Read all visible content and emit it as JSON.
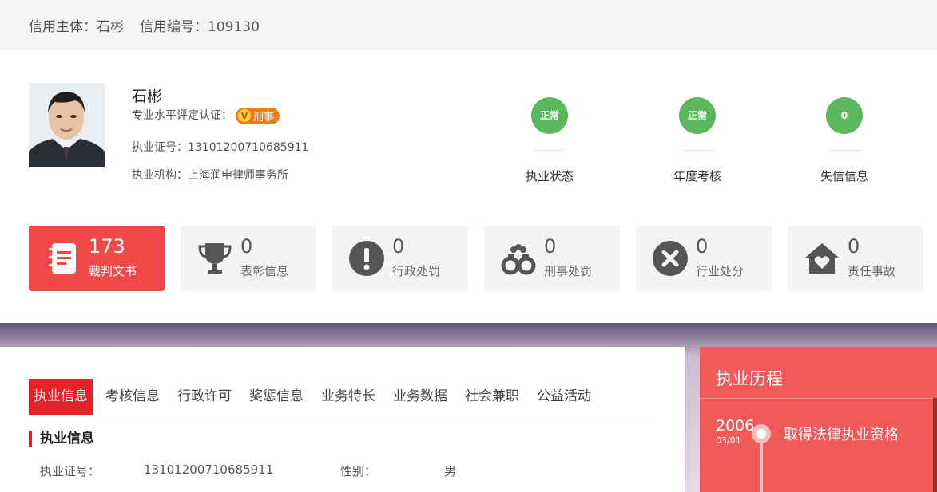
{
  "header": {
    "subject_label": "信用主体：",
    "subject_value": "石彬",
    "code_label": "信用编号：",
    "code_value": "109130"
  },
  "profile": {
    "name": "石彬",
    "cert_label": "专业水平评定认证：",
    "cert_badge": "刑事",
    "license_label": "执业证号：",
    "license_value": "13101200710685911",
    "org_label": "执业机构：",
    "org_value": "上海润申律师事务所"
  },
  "statuses": [
    {
      "value": "正常",
      "label": "执业状态"
    },
    {
      "value": "正常",
      "label": "年度考核"
    },
    {
      "value": "0",
      "label": "失信信息"
    }
  ],
  "stats": [
    {
      "icon": "document-icon",
      "value": "173",
      "label": "裁判文书",
      "active": true
    },
    {
      "icon": "trophy-icon",
      "value": "0",
      "label": "表彰信息"
    },
    {
      "icon": "exclamation-icon",
      "value": "0",
      "label": "行政处罚"
    },
    {
      "icon": "handcuffs-icon",
      "value": "0",
      "label": "刑事处罚"
    },
    {
      "icon": "x-circle-icon",
      "value": "0",
      "label": "行业处分"
    },
    {
      "icon": "house-heart-icon",
      "value": "0",
      "label": "责任事故"
    }
  ],
  "tabs": [
    "执业信息",
    "考核信息",
    "行政许可",
    "奖惩信息",
    "业务特长",
    "业务数据",
    "社会兼职",
    "公益活动"
  ],
  "section": {
    "title": "执业信息",
    "license_label": "执业证号：",
    "license_value": "13101200710685911",
    "gender_label": "性别：",
    "gender_value": "男"
  },
  "career": {
    "title": "执业历程",
    "year": "2006",
    "date": "03/01",
    "event": "取得法律执业资格"
  },
  "colors": {
    "accent": "#e0242a",
    "status_green": "#5cb85c",
    "card_active": "#f04848",
    "career_panel": "#f05a5a"
  }
}
